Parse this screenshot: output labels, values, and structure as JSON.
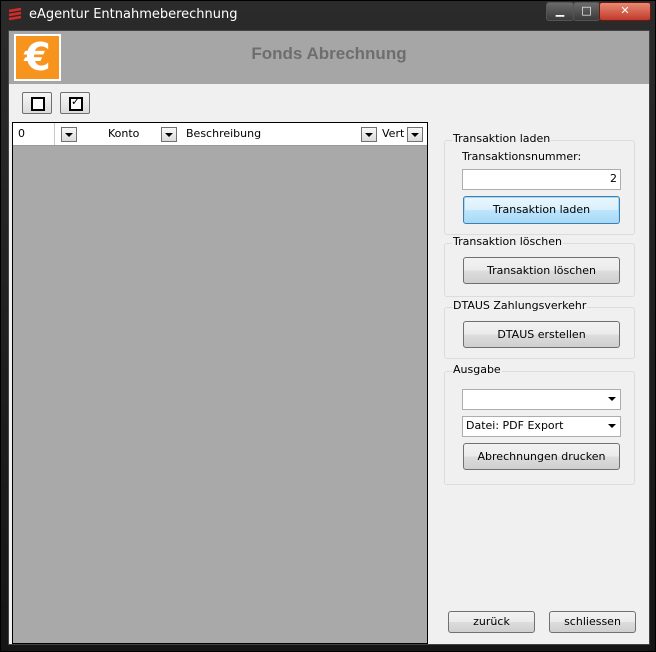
{
  "window": {
    "title": "eAgentur Entnahmeberechnung",
    "min_glyph": "▁",
    "max_glyph": "□",
    "close_glyph": "✕"
  },
  "header": {
    "title": "Fonds Abrechnung",
    "logo_glyph": "€",
    "logo_color": "#f7941d"
  },
  "toolbar": {
    "uncheck_all_icon": "checkbox-empty-icon",
    "check_all_icon": "checkbox-checked-icon",
    "check_glyph": "✓"
  },
  "grid": {
    "columns": [
      {
        "label": "0"
      },
      {
        "label": "Konto"
      },
      {
        "label": "Beschreibung"
      },
      {
        "label": "Vert"
      }
    ],
    "rows": []
  },
  "transaktion_laden": {
    "group_label": "Transaktion laden",
    "field_label": "Transaktionsnummer:",
    "field_value": "2",
    "button_label": "Transaktion laden"
  },
  "transaktion_loeschen": {
    "group_label": "Transaktion löschen",
    "button_label": "Transaktion löschen"
  },
  "dtaus": {
    "group_label": "DTAUS Zahlungsverkehr",
    "button_label": "DTAUS erstellen"
  },
  "ausgabe": {
    "group_label": "Ausgabe",
    "printer_value": "",
    "format_value": "Datei: PDF Export",
    "button_label": "Abrechnungen drucken"
  },
  "footer": {
    "back_label": "zurück",
    "close_label": "schliessen"
  }
}
